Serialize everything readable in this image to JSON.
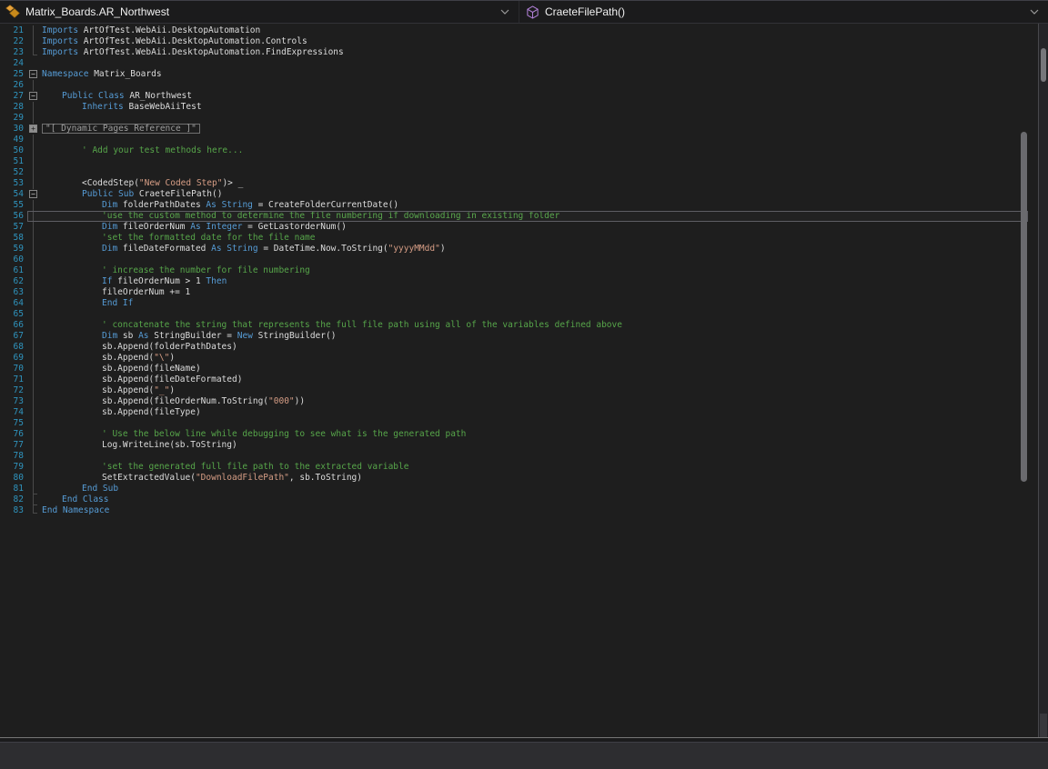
{
  "navbar": {
    "scope": {
      "label": "Matrix_Boards.AR_Northwest",
      "icon": "vb-class-icon"
    },
    "member": {
      "label": "CraeteFilePath()",
      "icon": "method-icon"
    }
  },
  "colors": {
    "bg": "#1e1e1e",
    "navbarBg": "#1b1b1c",
    "navText": "#f1f1f1",
    "lineNumber": "#2F94BE",
    "keyword": "#569CD6",
    "plain": "#DCDCDC",
    "comment": "#57A64A",
    "string": "#D69D85",
    "vbIconOrange": "#E8A33D",
    "methodIconPurple": "#B180D7"
  },
  "editor": {
    "current_line": 56,
    "collapsed_region_label": "\"[ Dynamic Pages Reference ]\"",
    "lines": [
      {
        "n": 21,
        "ind": 0,
        "out": "line",
        "t": [
          [
            "k",
            "Imports "
          ],
          [
            "p",
            "ArtOfTest.WebAii.DesktopAutomation"
          ]
        ]
      },
      {
        "n": 22,
        "ind": 0,
        "out": "line",
        "t": [
          [
            "k",
            "Imports "
          ],
          [
            "p",
            "ArtOfTest.WebAii.DesktopAutomation.Controls"
          ]
        ]
      },
      {
        "n": 23,
        "ind": 0,
        "out": "end",
        "t": [
          [
            "k",
            "Imports "
          ],
          [
            "p",
            "ArtOfTest.WebAii.DesktopAutomation.FindExpressions"
          ]
        ]
      },
      {
        "n": 24,
        "ind": 0,
        "out": "",
        "t": []
      },
      {
        "n": 25,
        "ind": 0,
        "out": "minus",
        "t": [
          [
            "k",
            "Namespace "
          ],
          [
            "p",
            "Matrix_Boards"
          ]
        ]
      },
      {
        "n": 26,
        "ind": 0,
        "out": "line",
        "t": []
      },
      {
        "n": 27,
        "ind": 4,
        "out": "minus",
        "t": [
          [
            "k",
            "Public Class "
          ],
          [
            "p",
            "AR_Northwest"
          ]
        ]
      },
      {
        "n": 28,
        "ind": 8,
        "out": "line",
        "t": [
          [
            "k",
            "Inherits "
          ],
          [
            "p",
            "BaseWebAiiTest"
          ]
        ]
      },
      {
        "n": 29,
        "ind": 0,
        "out": "line",
        "t": []
      },
      {
        "n": 30,
        "ind": 0,
        "out": "plus",
        "t": [
          [
            "r",
            "\"[ Dynamic Pages Reference ]\""
          ]
        ]
      },
      {
        "n": 49,
        "ind": 0,
        "out": "line",
        "t": []
      },
      {
        "n": 50,
        "ind": 8,
        "out": "line",
        "t": [
          [
            "c",
            "' Add your test methods here..."
          ]
        ]
      },
      {
        "n": 51,
        "ind": 0,
        "out": "line",
        "t": []
      },
      {
        "n": 52,
        "ind": 0,
        "out": "line",
        "t": []
      },
      {
        "n": 53,
        "ind": 8,
        "out": "line",
        "t": [
          [
            "p",
            "<CodedStep("
          ],
          [
            "s",
            "\"New Coded Step\""
          ],
          [
            "p",
            ")> _"
          ]
        ]
      },
      {
        "n": 54,
        "ind": 8,
        "out": "minus",
        "t": [
          [
            "k",
            "Public Sub "
          ],
          [
            "p",
            "CraeteFilePath()"
          ]
        ]
      },
      {
        "n": 55,
        "ind": 12,
        "out": "line",
        "t": [
          [
            "k",
            "Dim "
          ],
          [
            "p",
            "folderPathDates "
          ],
          [
            "k",
            "As String"
          ],
          [
            "p",
            " = CreateFolderCurrentDate()"
          ]
        ]
      },
      {
        "n": 56,
        "ind": 12,
        "out": "line",
        "t": [
          [
            "c",
            "'use the custom method to determine the file numbering if downloading in existing folder"
          ]
        ]
      },
      {
        "n": 57,
        "ind": 12,
        "out": "line",
        "t": [
          [
            "k",
            "Dim "
          ],
          [
            "p",
            "fileOrderNum "
          ],
          [
            "k",
            "As Integer"
          ],
          [
            "p",
            " = GetLastorderNum()"
          ]
        ]
      },
      {
        "n": 58,
        "ind": 12,
        "out": "line",
        "t": [
          [
            "c",
            "'set the formatted date for the file name"
          ]
        ]
      },
      {
        "n": 59,
        "ind": 12,
        "out": "line",
        "t": [
          [
            "k",
            "Dim "
          ],
          [
            "p",
            "fileDateFormated "
          ],
          [
            "k",
            "As String"
          ],
          [
            "p",
            " = DateTime.Now.ToString("
          ],
          [
            "s",
            "\"yyyyMMdd\""
          ],
          [
            "p",
            ")"
          ]
        ]
      },
      {
        "n": 60,
        "ind": 0,
        "out": "line",
        "t": []
      },
      {
        "n": 61,
        "ind": 12,
        "out": "line",
        "t": [
          [
            "c",
            "' increase the number for file numbering"
          ]
        ]
      },
      {
        "n": 62,
        "ind": 12,
        "out": "line",
        "t": [
          [
            "k",
            "If "
          ],
          [
            "p",
            "fileOrderNum > 1 "
          ],
          [
            "k",
            "Then"
          ]
        ]
      },
      {
        "n": 63,
        "ind": 12,
        "out": "line",
        "t": [
          [
            "p",
            "fileOrderNum += 1"
          ]
        ]
      },
      {
        "n": 64,
        "ind": 12,
        "out": "line",
        "t": [
          [
            "k",
            "End If"
          ]
        ]
      },
      {
        "n": 65,
        "ind": 0,
        "out": "line",
        "t": []
      },
      {
        "n": 66,
        "ind": 12,
        "out": "line",
        "t": [
          [
            "c",
            "' concatenate the string that represents the full file path using all of the variables defined above"
          ]
        ]
      },
      {
        "n": 67,
        "ind": 12,
        "out": "line",
        "t": [
          [
            "k",
            "Dim "
          ],
          [
            "p",
            "sb "
          ],
          [
            "k",
            "As "
          ],
          [
            "p",
            "StringBuilder = "
          ],
          [
            "k",
            "New "
          ],
          [
            "p",
            "StringBuilder()"
          ]
        ]
      },
      {
        "n": 68,
        "ind": 12,
        "out": "line",
        "t": [
          [
            "p",
            "sb.Append(folderPathDates)"
          ]
        ]
      },
      {
        "n": 69,
        "ind": 12,
        "out": "line",
        "t": [
          [
            "p",
            "sb.Append("
          ],
          [
            "s",
            "\"\\\""
          ],
          [
            "p",
            ")"
          ]
        ]
      },
      {
        "n": 70,
        "ind": 12,
        "out": "line",
        "t": [
          [
            "p",
            "sb.Append(fileName)"
          ]
        ]
      },
      {
        "n": 71,
        "ind": 12,
        "out": "line",
        "t": [
          [
            "p",
            "sb.Append(fileDateFormated)"
          ]
        ]
      },
      {
        "n": 72,
        "ind": 12,
        "out": "line",
        "t": [
          [
            "p",
            "sb.Append("
          ],
          [
            "s",
            "\"_\""
          ],
          [
            "p",
            ")"
          ]
        ]
      },
      {
        "n": 73,
        "ind": 12,
        "out": "line",
        "t": [
          [
            "p",
            "sb.Append(fileOrderNum.ToString("
          ],
          [
            "s",
            "\"000\""
          ],
          [
            "p",
            "))"
          ]
        ]
      },
      {
        "n": 74,
        "ind": 12,
        "out": "line",
        "t": [
          [
            "p",
            "sb.Append(fileType)"
          ]
        ]
      },
      {
        "n": 75,
        "ind": 0,
        "out": "line",
        "t": []
      },
      {
        "n": 76,
        "ind": 12,
        "out": "line",
        "t": [
          [
            "c",
            "' Use the below line while debugging to see what is the generated path"
          ]
        ]
      },
      {
        "n": 77,
        "ind": 12,
        "out": "line",
        "t": [
          [
            "p",
            "Log.WriteLine(sb.ToString)"
          ]
        ]
      },
      {
        "n": 78,
        "ind": 0,
        "out": "line",
        "t": []
      },
      {
        "n": 79,
        "ind": 12,
        "out": "line",
        "t": [
          [
            "c",
            "'set the generated full file path to the extracted variable"
          ]
        ]
      },
      {
        "n": 80,
        "ind": 12,
        "out": "line",
        "t": [
          [
            "p",
            "SetExtractedValue("
          ],
          [
            "s",
            "\"DownloadFilePath\""
          ],
          [
            "p",
            ", sb.ToString)"
          ]
        ]
      },
      {
        "n": 81,
        "ind": 8,
        "out": "corner",
        "t": [
          [
            "k",
            "End Sub"
          ]
        ]
      },
      {
        "n": 82,
        "ind": 4,
        "out": "corner",
        "t": [
          [
            "k",
            "End Class"
          ]
        ]
      },
      {
        "n": 83,
        "ind": 0,
        "out": "end",
        "t": [
          [
            "k",
            "End Namespace"
          ]
        ]
      }
    ]
  }
}
